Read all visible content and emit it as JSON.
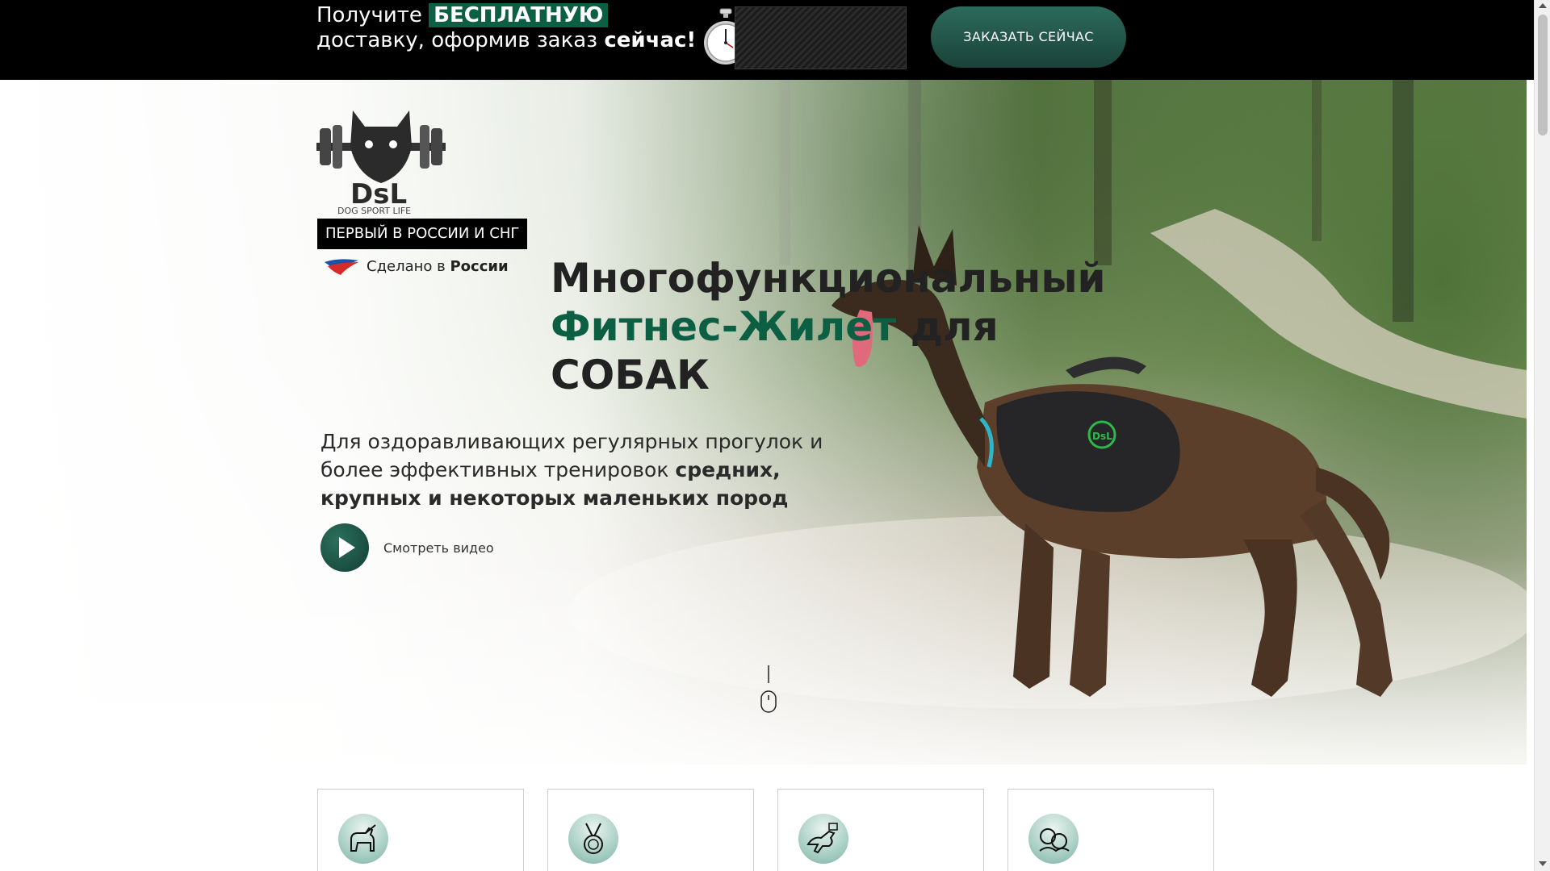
{
  "promo": {
    "line1_prefix": "Получите",
    "line1_highlight": "БЕСПЛАТНУЮ",
    "line2_prefix": "доставку, оформив заказ",
    "line2_bold": "сейчас!",
    "order_button": "ЗАКАЗАТЬ СЕЙЧАС"
  },
  "hero": {
    "logo_text": "DsL",
    "logo_subtext": "DOG SPORT LIFE",
    "badge": "ПЕРВЫЙ В РОССИИ И СНГ",
    "made_prefix": "Сделано в",
    "made_country": "России",
    "title_line1": "Многофункциональный",
    "title_line2_green": "Фитнес-Жилет",
    "title_line2_rest": "для",
    "title_line3": "СОБАК",
    "subtitle_plain": "Для оздоравливающих регулярных прогулок и более эффективных тренировок",
    "subtitle_bold": "средних, крупных и некоторых маленьких пород",
    "video_label": "Смотреть видео"
  },
  "cards": [
    {
      "icon": "guide-dog-icon"
    },
    {
      "icon": "medal-icon"
    },
    {
      "icon": "agility-dog-icon"
    },
    {
      "icon": "dog-breeds-icon"
    }
  ],
  "colors": {
    "brand_green": "#0d5f43",
    "button_dark_green": "#1a4239",
    "topbar_bg": "#000000"
  }
}
